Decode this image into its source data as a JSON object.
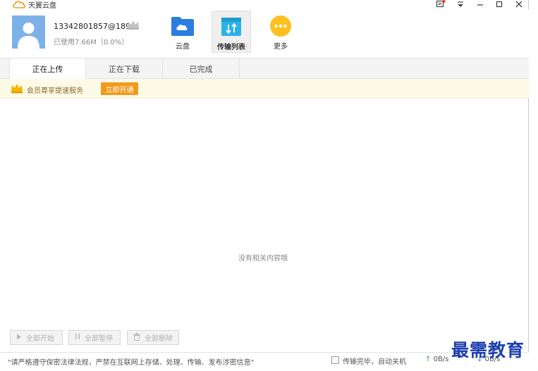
{
  "app": {
    "title": "天翼云盘"
  },
  "user": {
    "name": "13342801857@189...",
    "usage": "已使用7.66M（0.0%）"
  },
  "nav": [
    {
      "label": "云盘",
      "icon": "cloud-folder-icon"
    },
    {
      "label": "传输列表",
      "icon": "transfer-list-icon"
    },
    {
      "label": "更多",
      "icon": "more-icon"
    }
  ],
  "tabs": [
    {
      "label": "正在上传"
    },
    {
      "label": "正在下载"
    },
    {
      "label": "已完成"
    }
  ],
  "promo": {
    "text": "会员尊享提速服务",
    "button": "立即开通"
  },
  "empty_message": "没有相关内容哦",
  "actions": {
    "start_all": "全部开始",
    "pause_all": "全部暂停",
    "delete_all": "全部删除"
  },
  "status": {
    "notice": "\"请严格遵守保密法律法规，严禁在互联网上存储、处理、传输、发布涉密信息\"",
    "shutdown": "传输完毕，自动关机",
    "upload_speed": "0B/s",
    "download_speed": "0B/s"
  },
  "watermark": "最需教育",
  "colors": {
    "accent_orange": "#f39a1c",
    "brand_blue": "#2b7de0",
    "more_yellow": "#fcc01f"
  }
}
